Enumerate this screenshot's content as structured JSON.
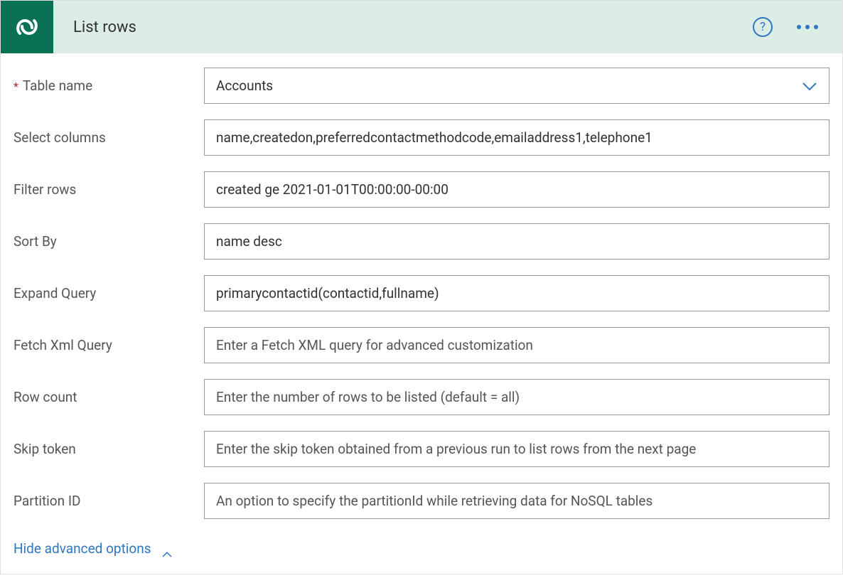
{
  "header": {
    "title": "List rows",
    "help_char": "?"
  },
  "fields": {
    "table_name": {
      "label": "Table name",
      "value": "Accounts",
      "required": true
    },
    "select_columns": {
      "label": "Select columns",
      "value": "name,createdon,preferredcontactmethodcode,emailaddress1,telephone1"
    },
    "filter_rows": {
      "label": "Filter rows",
      "value": "created ge 2021-01-01T00:00:00-00:00"
    },
    "sort_by": {
      "label": "Sort By",
      "value": "name desc"
    },
    "expand_query": {
      "label": "Expand Query",
      "value": "primarycontactid(contactid,fullname)"
    },
    "fetch_xml": {
      "label": "Fetch Xml Query",
      "placeholder": "Enter a Fetch XML query for advanced customization"
    },
    "row_count": {
      "label": "Row count",
      "placeholder": "Enter the number of rows to be listed (default = all)"
    },
    "skip_token": {
      "label": "Skip token",
      "placeholder": "Enter the skip token obtained from a previous run to list rows from the next page"
    },
    "partition_id": {
      "label": "Partition ID",
      "placeholder": "An option to specify the partitionId while retrieving data for NoSQL tables"
    }
  },
  "toggle": {
    "label": "Hide advanced options"
  },
  "colors": {
    "brand": "#0a7254",
    "accent": "#2f76c1"
  }
}
